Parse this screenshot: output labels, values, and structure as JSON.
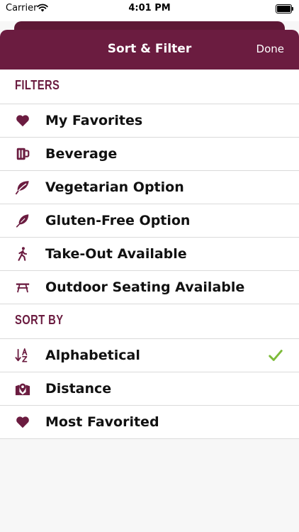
{
  "status_bar": {
    "carrier": "Carrier",
    "time": "4:01 PM"
  },
  "header": {
    "title": "Sort & Filter",
    "done_label": "Done"
  },
  "colors": {
    "brand": "#6b1c40",
    "check": "#7dbb3a"
  },
  "filters": {
    "heading": "FILTERS",
    "items": [
      {
        "label": "My Favorites",
        "icon": "heart-icon"
      },
      {
        "label": "Beverage",
        "icon": "beer-mug-icon"
      },
      {
        "label": "Vegetarian Option",
        "icon": "leaf-icon"
      },
      {
        "label": "Gluten-Free Option",
        "icon": "feather-icon"
      },
      {
        "label": "Take-Out Available",
        "icon": "walking-person-icon"
      },
      {
        "label": "Outdoor Seating Available",
        "icon": "picnic-table-icon"
      }
    ]
  },
  "sort": {
    "heading": "SORT BY",
    "selected": "Alphabetical",
    "items": [
      {
        "label": "Alphabetical",
        "icon": "sort-alpha-icon"
      },
      {
        "label": "Distance",
        "icon": "map-marker-icon"
      },
      {
        "label": "Most Favorited",
        "icon": "heart-icon"
      }
    ]
  }
}
